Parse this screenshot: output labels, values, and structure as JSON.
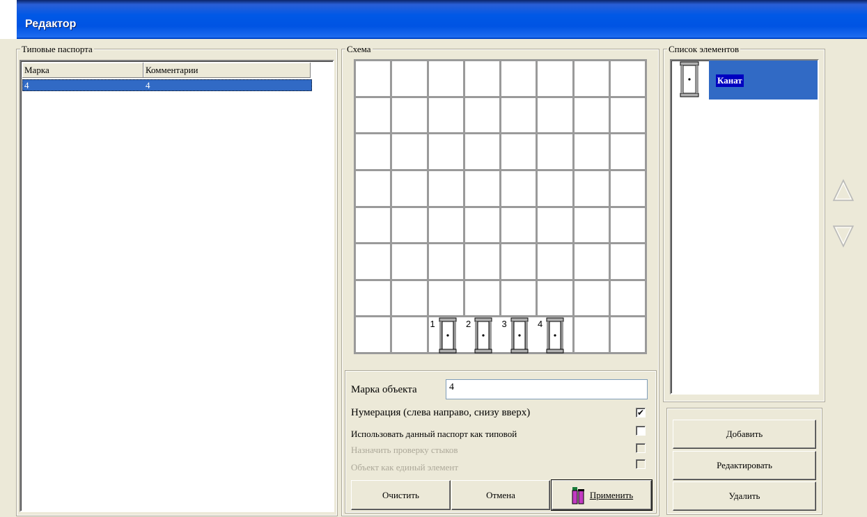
{
  "window": {
    "title": "Редактор"
  },
  "passports": {
    "group_label": "Типовые паспорта",
    "columns": [
      "Марка",
      "Комментарии"
    ],
    "rows": [
      {
        "mark": "4",
        "comment": "4"
      }
    ]
  },
  "scheme": {
    "group_label": "Схема",
    "grid": {
      "cols": 8,
      "rows": 8
    },
    "beams": [
      {
        "number": "1"
      },
      {
        "number": "2"
      },
      {
        "number": "3"
      },
      {
        "number": "4"
      }
    ]
  },
  "elements": {
    "group_label": "Список элементов",
    "items": [
      {
        "label": "Канат",
        "icon": "beam-icon"
      }
    ]
  },
  "properties": {
    "mark_label": "Марка объекта",
    "mark_value": "4",
    "numbering_label": "Нумерация (слева направо, снизу вверх)",
    "numbering_checked": true,
    "use_as_typical_label": "Использовать данный паспорт как типовой",
    "use_as_typical_checked": false,
    "assign_check_label": "Назначить проверку стыков",
    "assign_check_checked": false,
    "single_element_label": "Объект как единый элемент",
    "single_element_checked": false
  },
  "buttons": {
    "clear": "Очистить",
    "cancel": "Отмена",
    "apply": "Применить",
    "add": "Добавить",
    "edit": "Редактировать",
    "delete": "Удалить"
  },
  "icons": {
    "up": "triangle-up-icon",
    "down": "triangle-down-icon"
  }
}
